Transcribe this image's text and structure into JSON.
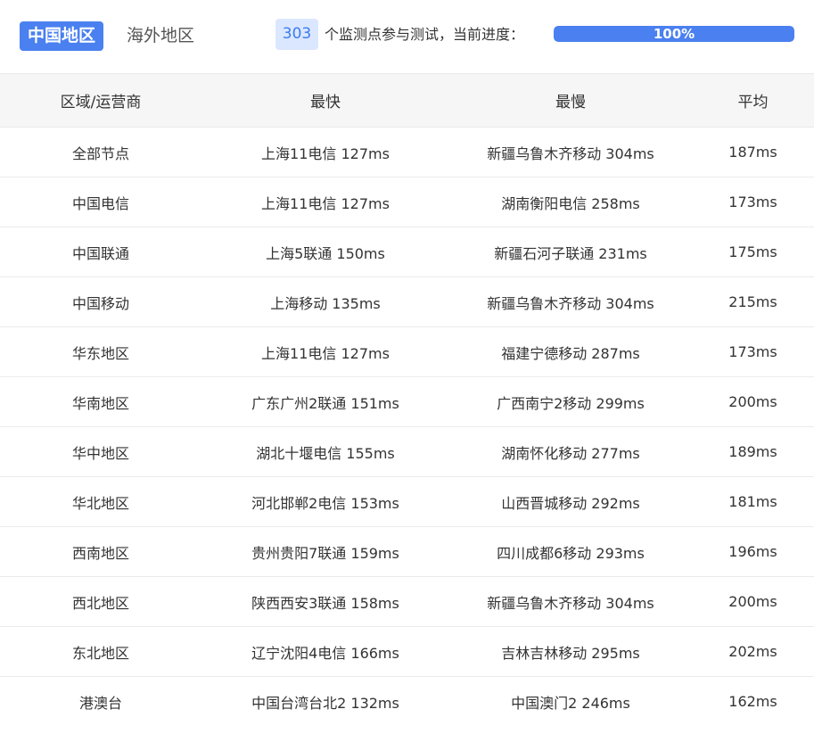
{
  "region_tabs": {
    "active": "中国地区",
    "inactive": "海外地区"
  },
  "progress": {
    "node_count": "303",
    "caption": "个监测点参与测试，当前进度：",
    "percent_label": "100%",
    "fraction": 1.0
  },
  "colors": {
    "accent": "#4a80f0",
    "badge_bg": "#dbe7ff",
    "header_bg": "#f6f6f6"
  },
  "table": {
    "headers": [
      "区域/运营商",
      "最快",
      "最慢",
      "平均"
    ],
    "rows": [
      [
        "全部节点",
        "上海11电信 127ms",
        "新疆乌鲁木齐移动 304ms",
        "187ms"
      ],
      [
        "中国电信",
        "上海11电信 127ms",
        "湖南衡阳电信 258ms",
        "173ms"
      ],
      [
        "中国联通",
        "上海5联通 150ms",
        "新疆石河子联通 231ms",
        "175ms"
      ],
      [
        "中国移动",
        "上海移动 135ms",
        "新疆乌鲁木齐移动 304ms",
        "215ms"
      ],
      [
        "华东地区",
        "上海11电信 127ms",
        "福建宁德移动 287ms",
        "173ms"
      ],
      [
        "华南地区",
        "广东广州2联通 151ms",
        "广西南宁2移动 299ms",
        "200ms"
      ],
      [
        "华中地区",
        "湖北十堰电信 155ms",
        "湖南怀化移动 277ms",
        "189ms"
      ],
      [
        "华北地区",
        "河北邯郸2电信 153ms",
        "山西晋城移动 292ms",
        "181ms"
      ],
      [
        "西南地区",
        "贵州贵阳7联通 159ms",
        "四川成都6移动 293ms",
        "196ms"
      ],
      [
        "西北地区",
        "陕西西安3联通 158ms",
        "新疆乌鲁木齐移动 304ms",
        "200ms"
      ],
      [
        "东北地区",
        "辽宁沈阳4电信 166ms",
        "吉林吉林移动 295ms",
        "202ms"
      ],
      [
        "港澳台",
        "中国台湾台北2 132ms",
        "中国澳门2 246ms",
        "162ms"
      ]
    ]
  }
}
